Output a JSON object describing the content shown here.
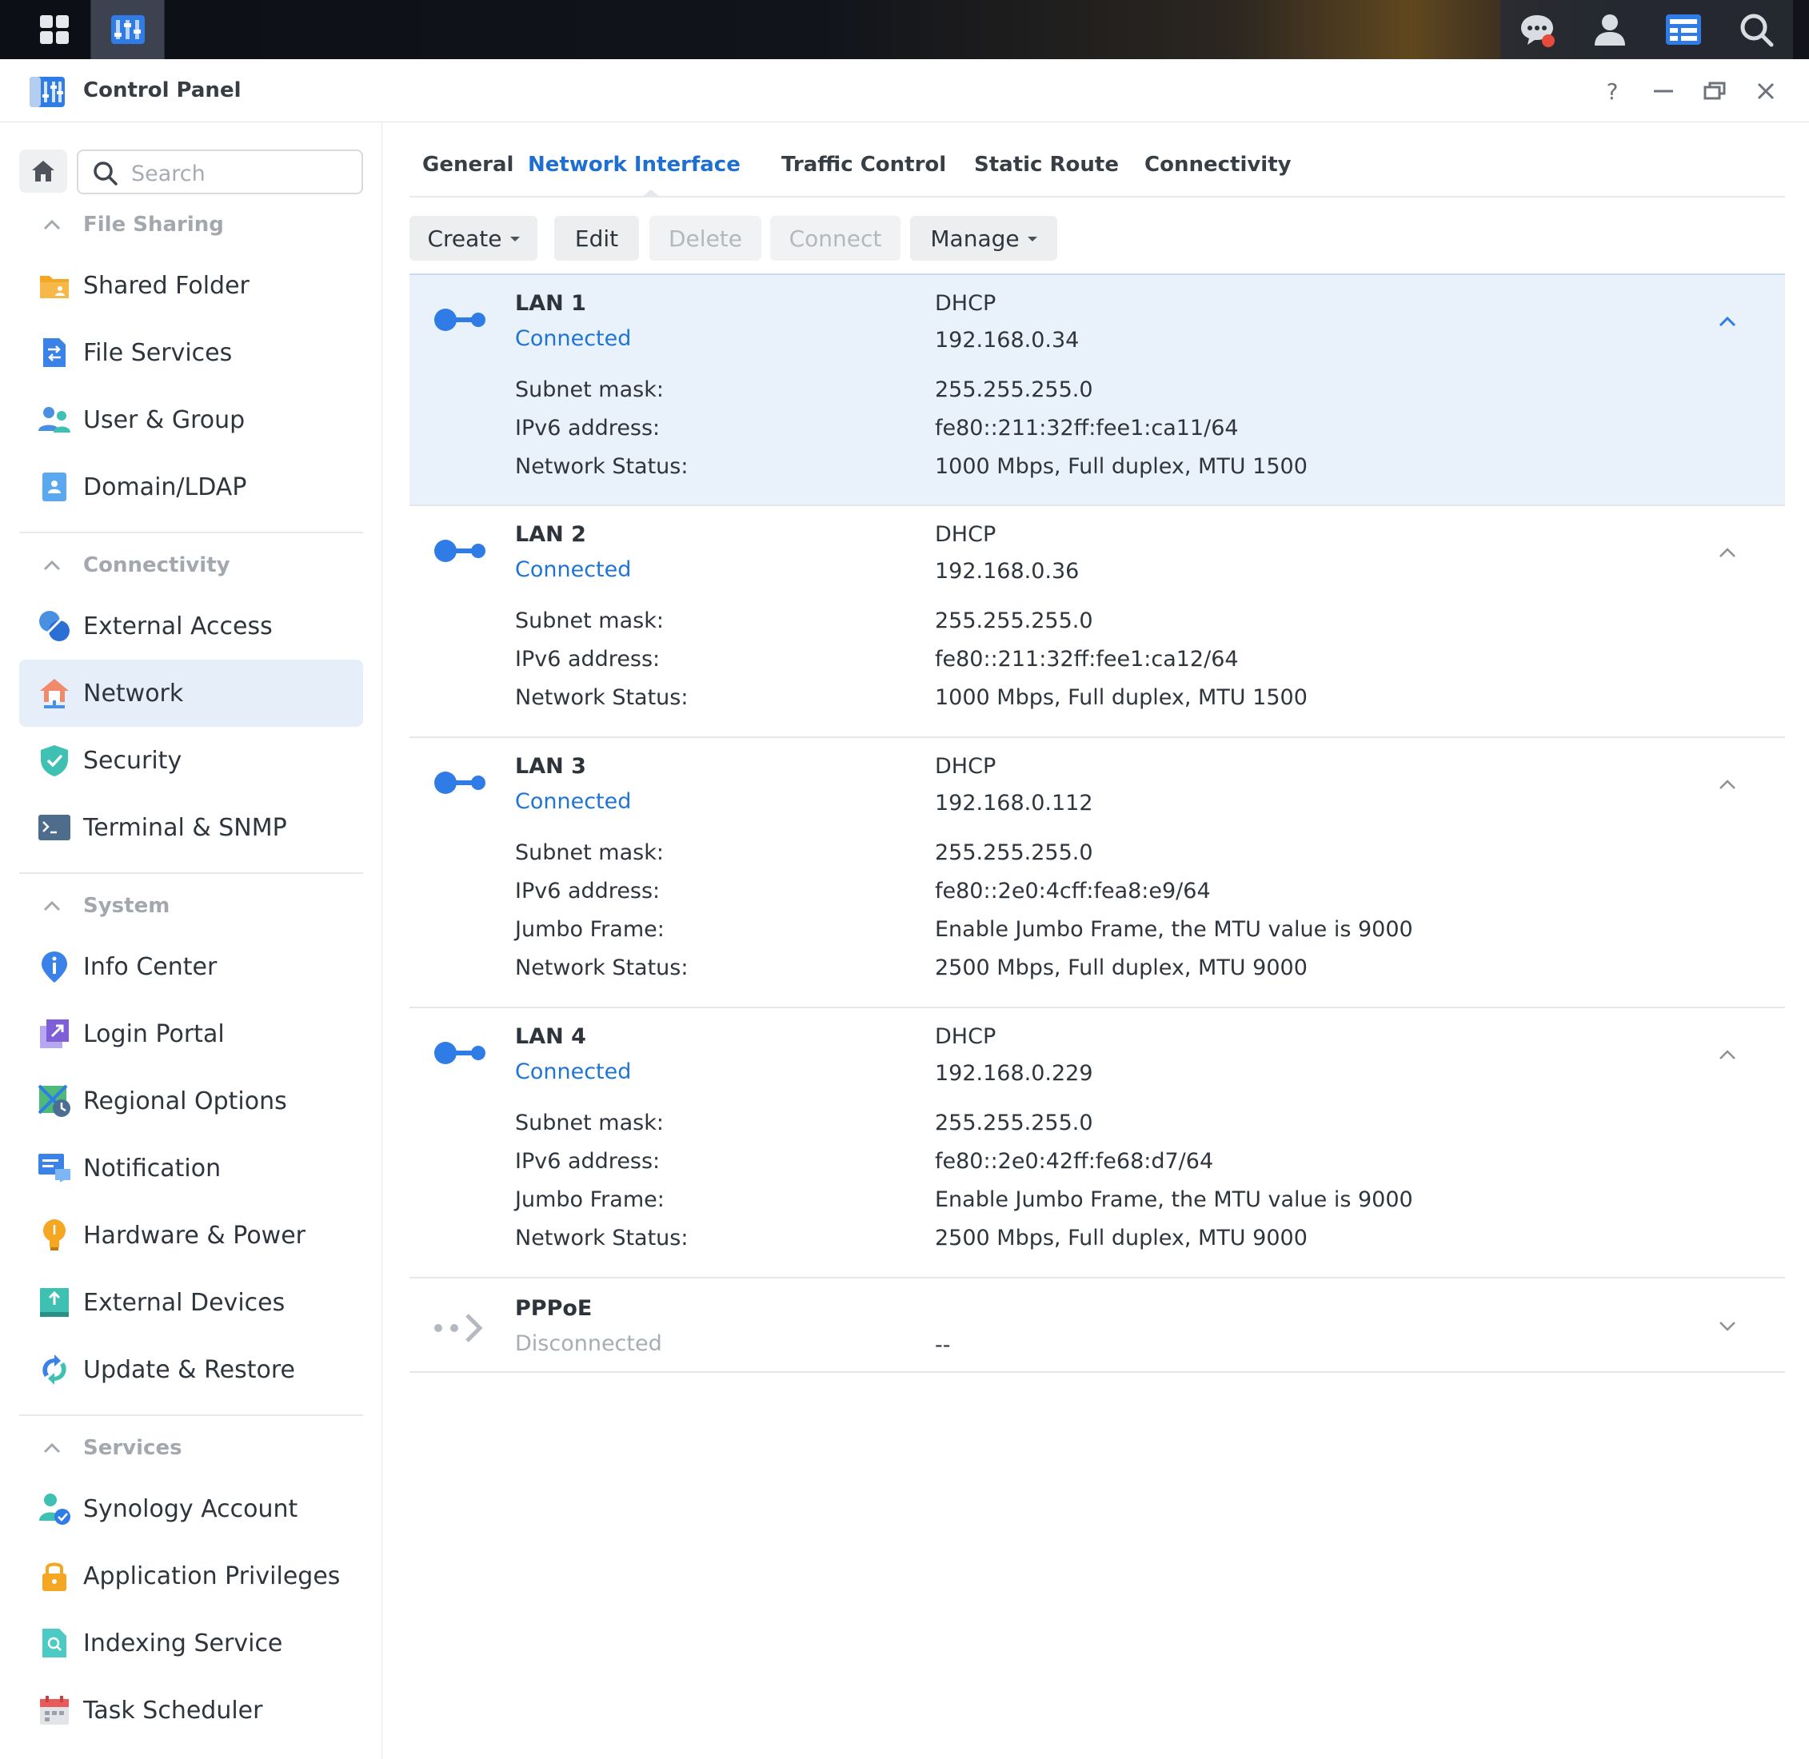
{
  "taskbar": {
    "left_icons": [
      "main-menu-icon",
      "control-panel-icon"
    ],
    "right_icons": [
      "notification-chat-icon",
      "user-icon",
      "widgets-icon",
      "search-icon"
    ],
    "notification_color": "#e84a3b"
  },
  "window": {
    "title": "Control Panel",
    "controls": [
      "?",
      "–",
      "restore",
      "×"
    ]
  },
  "sidebar": {
    "search_placeholder": "Search",
    "sections": [
      {
        "title": "File Sharing",
        "items": [
          {
            "label": "Shared Folder",
            "icon": "shared-folder-icon"
          },
          {
            "label": "File Services",
            "icon": "file-services-icon"
          },
          {
            "label": "User & Group",
            "icon": "user-group-icon"
          },
          {
            "label": "Domain/LDAP",
            "icon": "domain-ldap-icon"
          }
        ]
      },
      {
        "title": "Connectivity",
        "items": [
          {
            "label": "External Access",
            "icon": "external-access-icon"
          },
          {
            "label": "Network",
            "icon": "network-icon",
            "active": true
          },
          {
            "label": "Security",
            "icon": "security-shield-icon"
          },
          {
            "label": "Terminal & SNMP",
            "icon": "terminal-icon"
          }
        ]
      },
      {
        "title": "System",
        "items": [
          {
            "label": "Info Center",
            "icon": "info-icon"
          },
          {
            "label": "Login Portal",
            "icon": "login-portal-icon"
          },
          {
            "label": "Regional Options",
            "icon": "regional-options-icon"
          },
          {
            "label": "Notification",
            "icon": "notification-icon"
          },
          {
            "label": "Hardware & Power",
            "icon": "hardware-power-icon"
          },
          {
            "label": "External Devices",
            "icon": "external-devices-icon"
          },
          {
            "label": "Update & Restore",
            "icon": "update-restore-icon"
          }
        ]
      },
      {
        "title": "Services",
        "items": [
          {
            "label": "Synology Account",
            "icon": "synology-account-icon"
          },
          {
            "label": "Application Privileges",
            "icon": "application-privileges-icon"
          },
          {
            "label": "Indexing Service",
            "icon": "indexing-service-icon"
          },
          {
            "label": "Task Scheduler",
            "icon": "task-scheduler-icon"
          }
        ]
      }
    ]
  },
  "tabs": [
    {
      "label": "General"
    },
    {
      "label": "Network Interface",
      "active": true
    },
    {
      "label": "Traffic Control"
    },
    {
      "label": "Static Route"
    },
    {
      "label": "Connectivity"
    }
  ],
  "toolbar": {
    "create": "Create",
    "edit": "Edit",
    "delete": "Delete",
    "connect": "Connect",
    "manage": "Manage"
  },
  "interfaces": [
    {
      "name": "LAN 1",
      "status": "Connected",
      "mode": "DHCP",
      "ip": "192.168.0.34",
      "selected": true,
      "details": [
        {
          "label": "Subnet mask:",
          "value": "255.255.255.0"
        },
        {
          "label": "IPv6 address:",
          "value": "fe80::211:32ff:fee1:ca11/64"
        },
        {
          "label": "Network Status:",
          "value": "1000 Mbps, Full duplex, MTU 1500"
        }
      ]
    },
    {
      "name": "LAN 2",
      "status": "Connected",
      "mode": "DHCP",
      "ip": "192.168.0.36",
      "details": [
        {
          "label": "Subnet mask:",
          "value": "255.255.255.0"
        },
        {
          "label": "IPv6 address:",
          "value": "fe80::211:32ff:fee1:ca12/64"
        },
        {
          "label": "Network Status:",
          "value": "1000 Mbps, Full duplex, MTU 1500"
        }
      ]
    },
    {
      "name": "LAN 3",
      "status": "Connected",
      "mode": "DHCP",
      "ip": "192.168.0.112",
      "details": [
        {
          "label": "Subnet mask:",
          "value": "255.255.255.0"
        },
        {
          "label": "IPv6 address:",
          "value": "fe80::2e0:4cff:fea8:e9/64"
        },
        {
          "label": "Jumbo Frame:",
          "value": "Enable Jumbo Frame, the MTU value is 9000"
        },
        {
          "label": "Network Status:",
          "value": "2500 Mbps, Full duplex, MTU 9000"
        }
      ]
    },
    {
      "name": "LAN 4",
      "status": "Connected",
      "mode": "DHCP",
      "ip": "192.168.0.229",
      "details": [
        {
          "label": "Subnet mask:",
          "value": "255.255.255.0"
        },
        {
          "label": "IPv6 address:",
          "value": "fe80::2e0:42ff:fe68:d7/64"
        },
        {
          "label": "Jumbo Frame:",
          "value": "Enable Jumbo Frame, the MTU value is 9000"
        },
        {
          "label": "Network Status:",
          "value": "2500 Mbps, Full duplex, MTU 9000"
        }
      ]
    },
    {
      "name": "PPPoE",
      "status": "Disconnected",
      "mode": "",
      "ip": "--",
      "disconnected": true,
      "details": []
    }
  ],
  "colors": {
    "accent": "#1f6fd1",
    "selected_row": "#e9f1fb",
    "connected": "#1f74d4",
    "disconnected": "#a7adb4"
  }
}
